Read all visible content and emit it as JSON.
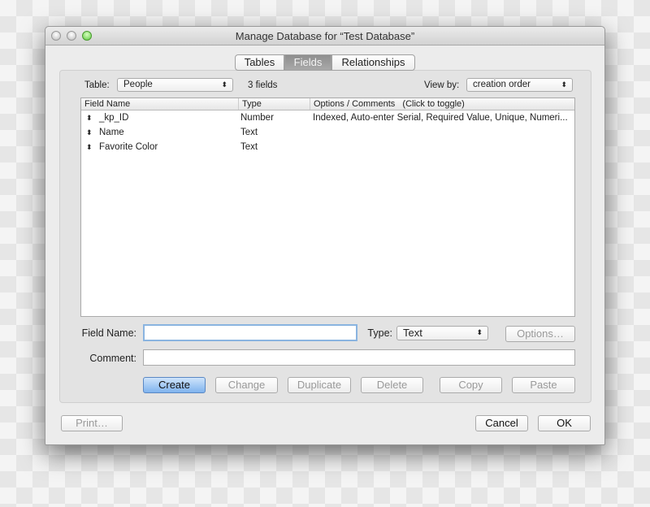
{
  "window": {
    "title": "Manage Database for “Test Database”"
  },
  "tabs": [
    {
      "label": "Tables",
      "selected": false
    },
    {
      "label": "Fields",
      "selected": true
    },
    {
      "label": "Relationships",
      "selected": false
    }
  ],
  "table_label": "Table:",
  "table_value": "People",
  "field_count": "3 fields",
  "viewby_label": "View by:",
  "viewby_value": "creation order",
  "list": {
    "headers": [
      "Field Name",
      "Type",
      "Options / Comments   (Click to toggle)"
    ],
    "rows": [
      {
        "name": "_kp_ID",
        "type": "Number",
        "options": "Indexed, Auto-enter Serial, Required Value, Unique, Numeri..."
      },
      {
        "name": "Name",
        "type": "Text",
        "options": ""
      },
      {
        "name": "Favorite Color",
        "type": "Text",
        "options": ""
      }
    ]
  },
  "form": {
    "field_name_label": "Field Name:",
    "field_name_value": "",
    "type_label": "Type:",
    "type_value": "Text",
    "options_label": "Options…",
    "comment_label": "Comment:",
    "comment_value": ""
  },
  "buttons": {
    "create": "Create",
    "change": "Change",
    "duplicate": "Duplicate",
    "delete": "Delete",
    "copy": "Copy",
    "paste": "Paste",
    "print": "Print…",
    "cancel": "Cancel",
    "ok": "OK"
  },
  "colors": {
    "default_button": "#7fb3ee",
    "selected_tab": "#9a9a9a",
    "zoom_light": "#5cc83e"
  }
}
